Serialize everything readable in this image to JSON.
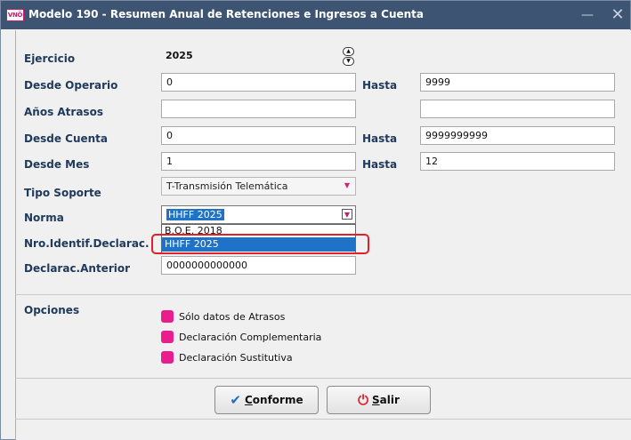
{
  "window": {
    "app_icon_text": "VNÖ",
    "title": "Modelo 190 - Resumen Anual de Retenciones e Ingresos a Cuenta",
    "minimize_glyph": "—",
    "close_glyph": "✕"
  },
  "form": {
    "ejercicio": {
      "label": "Ejercicio",
      "value": "2025"
    },
    "operario": {
      "label": "Desde Operario",
      "from": "0",
      "to_label": "Hasta",
      "to": "9999"
    },
    "atrasos": {
      "label": "Años Atrasos",
      "from": "",
      "to": ""
    },
    "cuenta": {
      "label": "Desde Cuenta",
      "from": "0",
      "to_label": "Hasta",
      "to": "9999999999"
    },
    "mes": {
      "label": "Desde Mes",
      "from": "1",
      "to_label": "Hasta",
      "to": "12"
    },
    "tipo_soporte": {
      "label": "Tipo Soporte",
      "value": "T-Transmisión Telemática"
    },
    "norma": {
      "label": "Norma",
      "value": "HHFF 2025",
      "options": [
        "B.O.E. 2018",
        "HHFF 2025"
      ]
    },
    "nro_identif": {
      "label": "Nro.Identif.Declarac."
    },
    "declarac_anterior": {
      "label": "Declarac.Anterior",
      "value": "0000000000000"
    }
  },
  "options": {
    "label": "Opciones",
    "items": [
      "Sólo datos de Atrasos",
      "Declaración Complementaria",
      "Declaración Sustitutiva"
    ]
  },
  "buttons": {
    "ok_first": "C",
    "ok_rest": "onforme",
    "exit_first": "S",
    "exit_rest": "alir"
  },
  "colors": {
    "titlebar": "#3d5473",
    "label_text": "#203a5c",
    "checkbox": "#e91e8c",
    "selection": "#1e73c8",
    "annotation_ring": "#e0202a"
  },
  "icons": {
    "ok": "checkmark-icon",
    "exit": "power-icon"
  }
}
